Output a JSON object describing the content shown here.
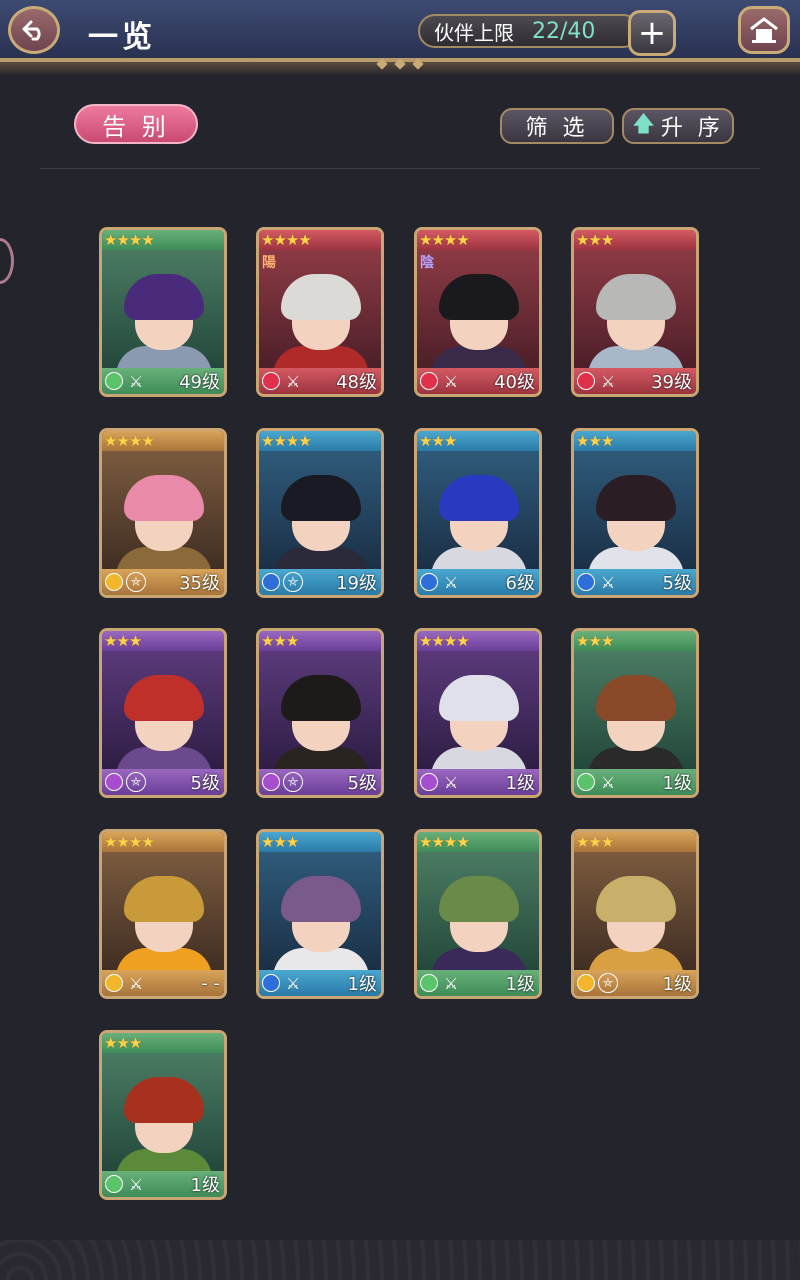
{
  "header": {
    "title": "一览",
    "capacity_label": "伙伴上限",
    "capacity_value": "22/40",
    "plus_label": "+",
    "back_icon": "back-arrow-icon",
    "home_icon": "home-icon"
  },
  "toolbar": {
    "farewell_label": "告 别",
    "filter_label": "筛 选",
    "sort_label": "升 序",
    "sort_arrow": "🡅"
  },
  "colors": {
    "green": "#3e8c58",
    "red": "#9c3440",
    "orange": "#a8743a",
    "blue": "#2a7aa8",
    "purple": "#6a3e98",
    "capacity_value": "#7fe0c8"
  },
  "cards": [
    {
      "stars": "★★★★",
      "frame": "g",
      "attr": "green",
      "weapon": "swords",
      "level": "49级",
      "hair": "#4a2a7a",
      "outfit": "#8a9ab0"
    },
    {
      "stars": "★★★★",
      "frame": "r",
      "attr": "red",
      "weapon": "swords",
      "level": "48级",
      "badge": "陽",
      "hair": "#dcdad6",
      "outfit": "#b02a2a"
    },
    {
      "stars": "★★★★",
      "frame": "r",
      "attr": "red",
      "weapon": "swords",
      "level": "40级",
      "badge": "陰",
      "hair": "#1a1a1e",
      "outfit": "#3a2a4a"
    },
    {
      "stars": "★★★",
      "frame": "r",
      "attr": "red",
      "weapon": "swords",
      "level": "39级",
      "hair": "#b8b8b6",
      "outfit": "#a8b8c8"
    },
    {
      "stars": "★★★★",
      "frame": "o",
      "attr": "yellow",
      "weapon": "pentagram",
      "level": "35级",
      "hair": "#e88aa8",
      "outfit": "#8a6a3a"
    },
    {
      "stars": "★★★★",
      "frame": "b",
      "attr": "blue",
      "weapon": "pentagram",
      "level": "19级",
      "hair": "#1a1a24",
      "outfit": "#2a2a3a"
    },
    {
      "stars": "★★★",
      "frame": "b",
      "attr": "blue",
      "weapon": "swords",
      "level": "6级",
      "hair": "#2a3ac0",
      "outfit": "#d8d8e0"
    },
    {
      "stars": "★★★",
      "frame": "b",
      "attr": "blue",
      "weapon": "swords",
      "level": "5级",
      "hair": "#2a1e24",
      "outfit": "#e0e4ea"
    },
    {
      "stars": "★★★",
      "frame": "p",
      "attr": "purple",
      "weapon": "pentagram",
      "level": "5级",
      "hair": "#c0302a",
      "outfit": "#6a4a8a"
    },
    {
      "stars": "★★★",
      "frame": "p",
      "attr": "purple",
      "weapon": "pentagram",
      "level": "5级",
      "hair": "#1e1a1a",
      "outfit": "#2a2420"
    },
    {
      "stars": "★★★★",
      "frame": "p",
      "attr": "purple",
      "weapon": "swords",
      "level": "1级",
      "hair": "#e0e0ea",
      "outfit": "#d8d8e0"
    },
    {
      "stars": "★★★",
      "frame": "g",
      "attr": "green",
      "weapon": "swords",
      "level": "1级",
      "hair": "#8a4a2a",
      "outfit": "#2a2a2a"
    },
    {
      "stars": "★★★★",
      "frame": "o",
      "attr": "yellow",
      "weapon": "swords",
      "level": "- -",
      "hair": "#c89a3a",
      "outfit": "#f0a020"
    },
    {
      "stars": "★★★",
      "frame": "b",
      "attr": "blue",
      "weapon": "swords",
      "level": "1级",
      "hair": "#7a5a8a",
      "outfit": "#e8e8ea"
    },
    {
      "stars": "★★★★",
      "frame": "g",
      "attr": "green",
      "weapon": "swords",
      "level": "1级",
      "hair": "#6a8a4a",
      "outfit": "#3a2a5a"
    },
    {
      "stars": "★★★",
      "frame": "o",
      "attr": "yellow",
      "weapon": "pentagram",
      "level": "1级",
      "hair": "#c8b06a",
      "outfit": "#d8a040"
    },
    {
      "stars": "★★★",
      "frame": "g",
      "attr": "green",
      "weapon": "swords",
      "level": "1级",
      "hair": "#a8301e",
      "outfit": "#5a8a3a"
    }
  ]
}
